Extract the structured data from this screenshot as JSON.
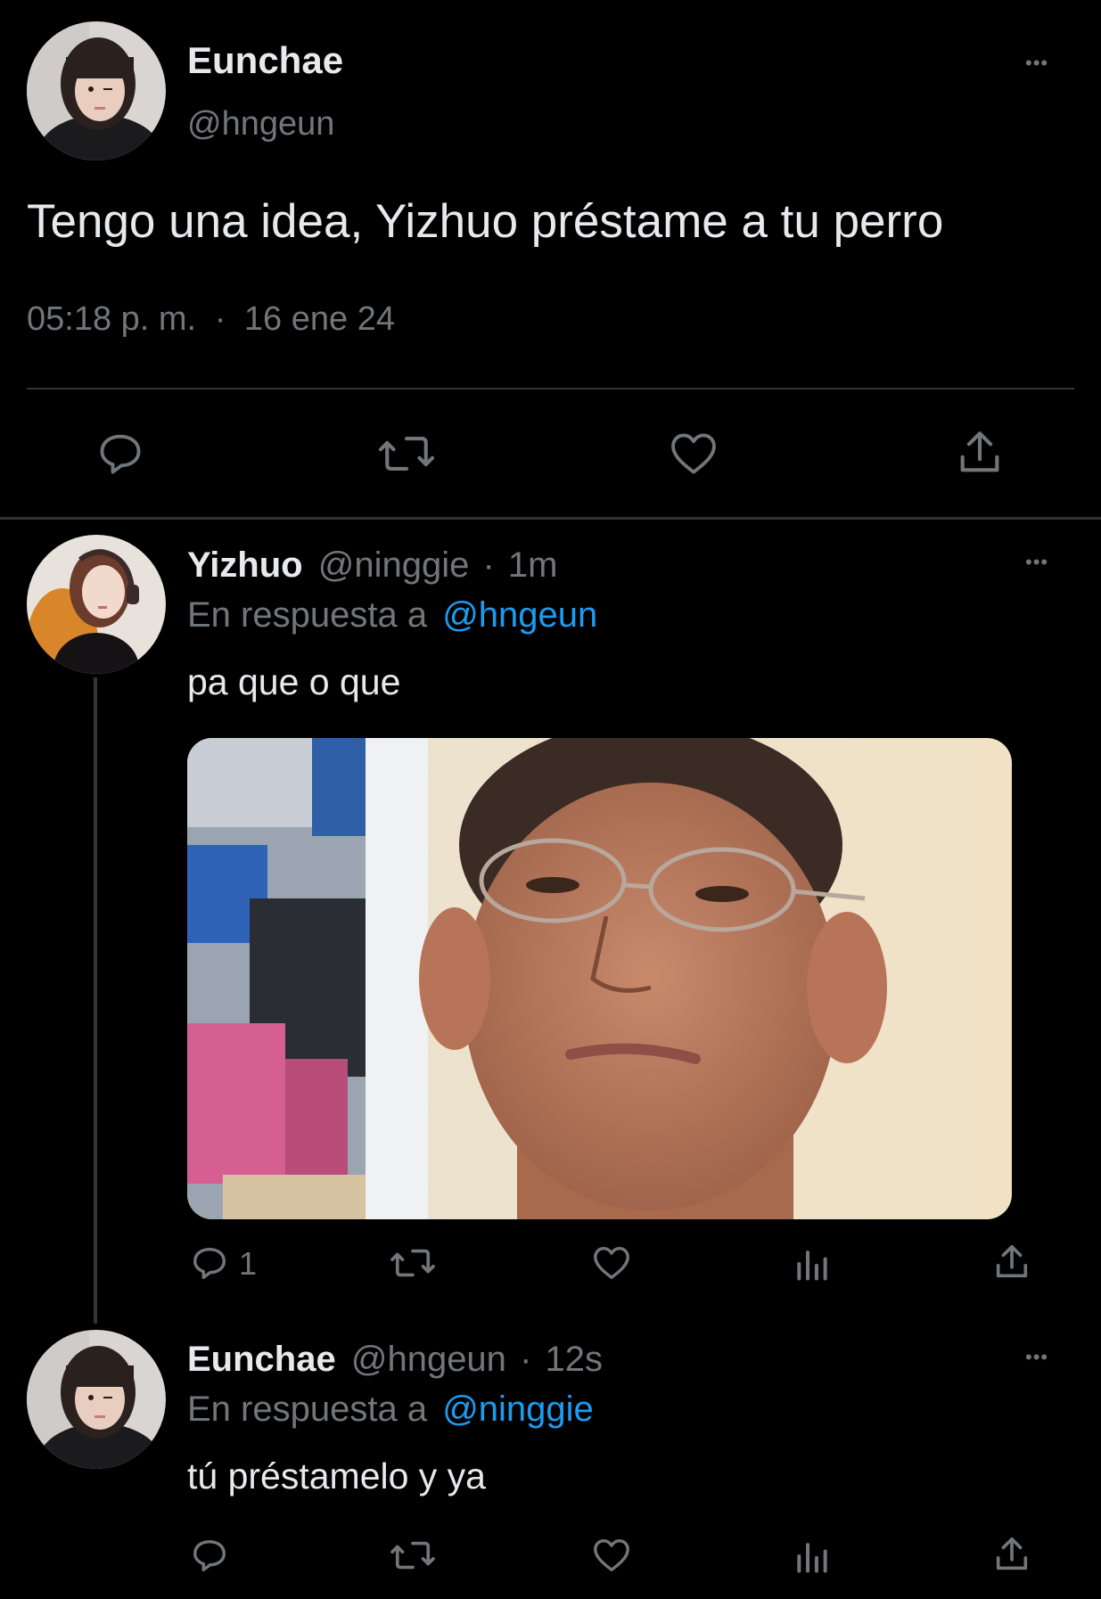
{
  "main_tweet": {
    "author": "Eunchae",
    "handle": "@hngeun",
    "text": "Tengo una idea, Yizhuo préstame a tu perro",
    "time": "05:18 p. m.",
    "separator": "·",
    "date": "16 ene 24",
    "more_label": "•••"
  },
  "reply1": {
    "author": "Yizhuo",
    "handle": "@ninggie",
    "separator": "·",
    "time": "1m",
    "reply_prefix": "En respuesta a",
    "reply_to": "@hngeun",
    "text": "pa que o que",
    "reply_count": "1",
    "more_label": "•••"
  },
  "reply2": {
    "author": "Eunchae",
    "handle": "@hngeun",
    "separator": "·",
    "time": "12s",
    "reply_prefix": "En respuesta a",
    "reply_to": "@ninggie",
    "text": "tú préstamelo y ya",
    "more_label": "•••"
  },
  "icons": {
    "reply": "reply-icon",
    "retweet": "retweet-icon",
    "like": "heart-icon",
    "views": "views-icon",
    "share": "share-icon"
  },
  "colors": {
    "background": "#000000",
    "text": "#e7e9ea",
    "muted": "#71767b",
    "link": "#1d9bf0",
    "divider": "#2f3336"
  }
}
